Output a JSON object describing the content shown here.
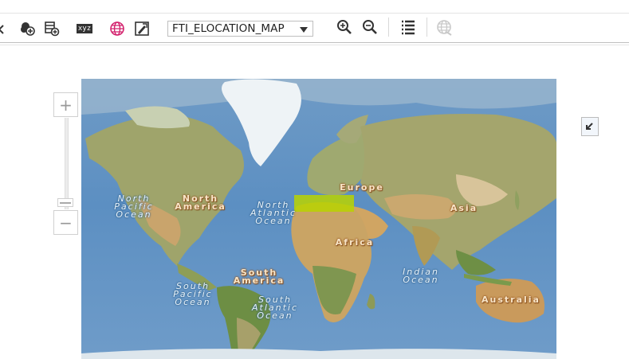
{
  "toolbar": {
    "map_select": {
      "value": "FTI_ELOCATION_MAP",
      "options": [
        "FTI_ELOCATION_MAP"
      ]
    },
    "xyz_label": "xyz",
    "icons": [
      "arrow-icon",
      "layer-add-icon",
      "table-add-icon",
      "xyz-icon",
      "globe-icon",
      "map-edit-icon",
      "zoom-in-icon",
      "zoom-out-icon",
      "list-icon",
      "globe-disabled-icon"
    ]
  },
  "map": {
    "base": "world-physical",
    "labels": {
      "north_pacific": "North Pacific Ocean",
      "north_america": "North America",
      "north_atlantic": "North Atlantic Ocean",
      "europe": "Europe",
      "asia": "Asia",
      "africa": "Africa",
      "south_america": "South America",
      "indian": "Indian Ocean",
      "south_pacific": "South Pacific Ocean",
      "south_atlantic": "South Atlantic Ocean",
      "australia": "Australia"
    },
    "highlight_color": "#b8d400"
  },
  "zoom": {
    "in_label": "+",
    "out_label": "−"
  }
}
